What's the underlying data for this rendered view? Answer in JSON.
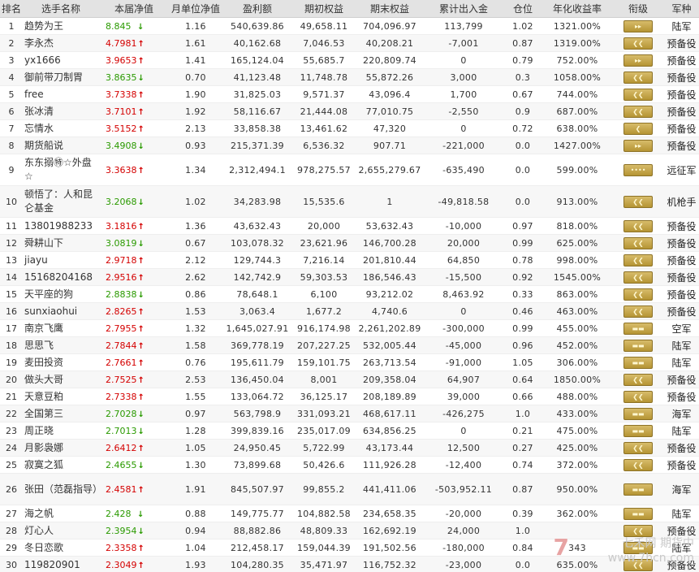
{
  "columns": [
    "排名",
    "选手名称",
    "本届净值",
    "月单位净值",
    "盈利额",
    "期初权益",
    "期末权益",
    "累计出入金",
    "仓位",
    "年化收益率",
    "衔级",
    "军种"
  ],
  "rows": [
    {
      "rank": "1",
      "name": "趋势为王",
      "nav": "8.845",
      "dir": "down",
      "monthly": "1.16",
      "profit": "540,639.86",
      "init": "49,658.11",
      "final": "704,096.97",
      "flow": "113,799",
      "pos": "1.02",
      "annual": "1321.00%",
      "badge": "▸▸",
      "arm": "陆军"
    },
    {
      "rank": "2",
      "name": "李永杰",
      "nav": "4.7981",
      "dir": "up",
      "monthly": "1.61",
      "profit": "40,162.68",
      "init": "7,046.53",
      "final": "40,208.21",
      "flow": "-7,001",
      "pos": "0.87",
      "annual": "1319.00%",
      "badge": "❮❮",
      "arm": "预备役"
    },
    {
      "rank": "3",
      "name": "yx1666",
      "nav": "3.9653",
      "dir": "up",
      "monthly": "1.41",
      "profit": "165,124.04",
      "init": "55,685.7",
      "final": "220,809.74",
      "flow": "0",
      "pos": "0.79",
      "annual": "752.00%",
      "badge": "▸▸",
      "arm": "预备役"
    },
    {
      "rank": "4",
      "name": "御前带刀制胃",
      "nav": "3.8635",
      "dir": "down",
      "monthly": "0.70",
      "profit": "41,123.48",
      "init": "11,748.78",
      "final": "55,872.26",
      "flow": "3,000",
      "pos": "0.3",
      "annual": "1058.00%",
      "badge": "❮❮",
      "arm": "预备役"
    },
    {
      "rank": "5",
      "name": "free",
      "nav": "3.7338",
      "dir": "up",
      "monthly": "1.90",
      "profit": "31,825.03",
      "init": "9,571.37",
      "final": "43,096.4",
      "flow": "1,700",
      "pos": "0.67",
      "annual": "744.00%",
      "badge": "❮❮",
      "arm": "预备役"
    },
    {
      "rank": "6",
      "name": "张冰清",
      "nav": "3.7101",
      "dir": "up",
      "monthly": "1.92",
      "profit": "58,116.67",
      "init": "21,444.08",
      "final": "77,010.75",
      "flow": "-2,550",
      "pos": "0.9",
      "annual": "687.00%",
      "badge": "❮❮",
      "arm": "预备役"
    },
    {
      "rank": "7",
      "name": "忘情水",
      "nav": "3.5152",
      "dir": "up",
      "monthly": "2.13",
      "profit": "33,858.38",
      "init": "13,461.62",
      "final": "47,320",
      "flow": "0",
      "pos": "0.72",
      "annual": "638.00%",
      "badge": "❮",
      "arm": "预备役"
    },
    {
      "rank": "8",
      "name": "期货船说",
      "nav": "3.4908",
      "dir": "down",
      "monthly": "0.93",
      "profit": "215,371.39",
      "init": "6,536.32",
      "final": "907.71",
      "flow": "-221,000",
      "pos": "0.0",
      "annual": "1427.00%",
      "badge": "▸▸",
      "arm": "预备役"
    },
    {
      "rank": "9",
      "name": "东东搦㊕☆外盘☆",
      "nav": "3.3638",
      "dir": "up",
      "monthly": "1.34",
      "profit": "2,312,494.1",
      "init": "978,275.57",
      "final": "2,655,279.67",
      "flow": "-635,490",
      "pos": "0.0",
      "annual": "599.00%",
      "badge": "••••",
      "arm": "远征军",
      "tall": true
    },
    {
      "rank": "10",
      "name": "顿悟了：人和昆仑基金",
      "nav": "3.2068",
      "dir": "down",
      "monthly": "1.02",
      "profit": "34,283.98",
      "init": "15,535.6",
      "final": "1",
      "flow": "-49,818.58",
      "pos": "0.0",
      "annual": "913.00%",
      "badge": "❮❮",
      "arm": "机枪手",
      "tall": true
    },
    {
      "rank": "11",
      "name": "13801988233",
      "nav": "3.1816",
      "dir": "up",
      "monthly": "1.36",
      "profit": "43,632.43",
      "init": "20,000",
      "final": "53,632.43",
      "flow": "-10,000",
      "pos": "0.97",
      "annual": "818.00%",
      "badge": "❮❮",
      "arm": "预备役"
    },
    {
      "rank": "12",
      "name": "舜耕山下",
      "nav": "3.0819",
      "dir": "down",
      "monthly": "0.67",
      "profit": "103,078.32",
      "init": "23,621.96",
      "final": "146,700.28",
      "flow": "20,000",
      "pos": "0.99",
      "annual": "625.00%",
      "badge": "❮❮",
      "arm": "预备役"
    },
    {
      "rank": "13",
      "name": "jiayu",
      "nav": "2.9718",
      "dir": "up",
      "monthly": "2.12",
      "profit": "129,744.3",
      "init": "7,216.14",
      "final": "201,810.44",
      "flow": "64,850",
      "pos": "0.78",
      "annual": "998.00%",
      "badge": "❮❮",
      "arm": "预备役"
    },
    {
      "rank": "14",
      "name": "15168204168",
      "nav": "2.9516",
      "dir": "up",
      "monthly": "2.62",
      "profit": "142,742.9",
      "init": "59,303.53",
      "final": "186,546.43",
      "flow": "-15,500",
      "pos": "0.92",
      "annual": "1545.00%",
      "badge": "❮❮",
      "arm": "预备役"
    },
    {
      "rank": "15",
      "name": "天平座的狗",
      "nav": "2.8838",
      "dir": "down",
      "monthly": "0.86",
      "profit": "78,648.1",
      "init": "6,100",
      "final": "93,212.02",
      "flow": "8,463.92",
      "pos": "0.33",
      "annual": "863.00%",
      "badge": "❮❮",
      "arm": "预备役"
    },
    {
      "rank": "16",
      "name": "sunxiaohui",
      "nav": "2.8265",
      "dir": "up",
      "monthly": "1.53",
      "profit": "3,063.4",
      "init": "1,677.2",
      "final": "4,740.6",
      "flow": "0",
      "pos": "0.46",
      "annual": "463.00%",
      "badge": "❮❮",
      "arm": "预备役"
    },
    {
      "rank": "17",
      "name": "南京飞鹰",
      "nav": "2.7955",
      "dir": "up",
      "monthly": "1.32",
      "profit": "1,645,027.91",
      "init": "916,174.98",
      "final": "2,261,202.89",
      "flow": "-300,000",
      "pos": "0.99",
      "annual": "455.00%",
      "badge": "▬▬",
      "arm": "空军"
    },
    {
      "rank": "18",
      "name": "思思飞",
      "nav": "2.7844",
      "dir": "up",
      "monthly": "1.58",
      "profit": "369,778.19",
      "init": "207,227.25",
      "final": "532,005.44",
      "flow": "-45,000",
      "pos": "0.96",
      "annual": "452.00%",
      "badge": "▬▬",
      "arm": "陆军"
    },
    {
      "rank": "19",
      "name": "麦田投资",
      "nav": "2.7661",
      "dir": "up",
      "monthly": "0.76",
      "profit": "195,611.79",
      "init": "159,101.75",
      "final": "263,713.54",
      "flow": "-91,000",
      "pos": "1.05",
      "annual": "306.00%",
      "badge": "▬▬",
      "arm": "陆军"
    },
    {
      "rank": "20",
      "name": "做头大哥",
      "nav": "2.7525",
      "dir": "up",
      "monthly": "2.53",
      "profit": "136,450.04",
      "init": "8,001",
      "final": "209,358.04",
      "flow": "64,907",
      "pos": "0.64",
      "annual": "1850.00%",
      "badge": "❮❮",
      "arm": "预备役"
    },
    {
      "rank": "21",
      "name": "天意豆粕",
      "nav": "2.7338",
      "dir": "up",
      "monthly": "1.55",
      "profit": "133,064.72",
      "init": "36,125.17",
      "final": "208,189.89",
      "flow": "39,000",
      "pos": "0.66",
      "annual": "488.00%",
      "badge": "❮❮",
      "arm": "预备役"
    },
    {
      "rank": "22",
      "name": "全国第三",
      "nav": "2.7028",
      "dir": "down",
      "monthly": "0.97",
      "profit": "563,798.9",
      "init": "331,093.21",
      "final": "468,617.11",
      "flow": "-426,275",
      "pos": "1.0",
      "annual": "433.00%",
      "badge": "▬▬",
      "arm": "海军"
    },
    {
      "rank": "23",
      "name": "周正晓",
      "nav": "2.7013",
      "dir": "down",
      "monthly": "1.28",
      "profit": "399,839.16",
      "init": "235,017.09",
      "final": "634,856.25",
      "flow": "0",
      "pos": "0.21",
      "annual": "475.00%",
      "badge": "▬▬",
      "arm": "陆军"
    },
    {
      "rank": "24",
      "name": "月影袅娜",
      "nav": "2.6412",
      "dir": "up",
      "monthly": "1.05",
      "profit": "24,950.45",
      "init": "5,722.99",
      "final": "43,173.44",
      "flow": "12,500",
      "pos": "0.27",
      "annual": "425.00%",
      "badge": "❮❮",
      "arm": "预备役"
    },
    {
      "rank": "25",
      "name": "寂寞之狐",
      "nav": "2.4655",
      "dir": "down",
      "monthly": "1.30",
      "profit": "73,899.68",
      "init": "50,426.6",
      "final": "111,926.28",
      "flow": "-12,400",
      "pos": "0.74",
      "annual": "372.00%",
      "badge": "❮❮",
      "arm": "预备役"
    },
    {
      "rank": "26",
      "name": "张田（范磊指导）",
      "nav": "2.4581",
      "dir": "up",
      "monthly": "1.91",
      "profit": "845,507.97",
      "init": "99,855.2",
      "final": "441,411.06",
      "flow": "-503,952.11",
      "pos": "0.87",
      "annual": "950.00%",
      "badge": "▬▬",
      "arm": "海军",
      "tall": true
    },
    {
      "rank": "27",
      "name": "海之帆",
      "nav": "2.428",
      "dir": "down",
      "monthly": "0.88",
      "profit": "149,775.77",
      "init": "104,882.58",
      "final": "234,658.35",
      "flow": "-20,000",
      "pos": "0.39",
      "annual": "362.00%",
      "badge": "▬▬",
      "arm": "陆军"
    },
    {
      "rank": "28",
      "name": "灯心人",
      "nav": "2.3954",
      "dir": "down",
      "monthly": "0.94",
      "profit": "88,882.86",
      "init": "48,809.33",
      "final": "162,692.19",
      "flow": "24,000",
      "pos": "1.0",
      "annual": "",
      "badge": "❮❮",
      "arm": "预备役"
    },
    {
      "rank": "29",
      "name": "冬日恋歌",
      "nav": "2.3358",
      "dir": "up",
      "monthly": "1.04",
      "profit": "212,458.17",
      "init": "159,044.39",
      "final": "191,502.56",
      "flow": "-180,000",
      "pos": "0.84",
      "annual": "343",
      "badge": "▬▬",
      "arm": "陆军"
    },
    {
      "rank": "30",
      "name": "119820901",
      "nav": "2.3049",
      "dir": "up",
      "monthly": "1.93",
      "profit": "104,280.35",
      "init": "35,471.97",
      "final": "116,752.32",
      "flow": "-23,000",
      "pos": "0.0",
      "annual": "635.00%",
      "badge": "❮❮",
      "arm": "预备役"
    }
  ],
  "watermark": {
    "brand": "七禾网 期货中",
    "url": "www.7hcn.com"
  }
}
